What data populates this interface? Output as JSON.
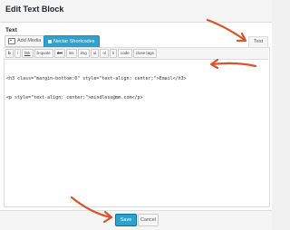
{
  "modal": {
    "title": "Edit Text Block"
  },
  "field": {
    "label": "Text"
  },
  "media_buttons": {
    "add_media": "Add Media",
    "nectar": "Nectar Shortcodes"
  },
  "editor_tabs": {
    "text": "Text"
  },
  "quicktags": [
    {
      "label": "b",
      "icon": "bold"
    },
    {
      "label": "i",
      "icon": "italic"
    },
    {
      "label": "link",
      "icon": "link"
    },
    {
      "label": "b-quote",
      "icon": "blockquote"
    },
    {
      "label": "del",
      "icon": "strikethrough"
    },
    {
      "label": "ins",
      "icon": "insert"
    },
    {
      "label": "img",
      "icon": "image"
    },
    {
      "label": "ul",
      "icon": "unordered-list"
    },
    {
      "label": "ol",
      "icon": "ordered-list"
    },
    {
      "label": "li",
      "icon": "list-item"
    },
    {
      "label": "code",
      "icon": "code"
    },
    {
      "label": "close tags",
      "icon": "close-tags"
    }
  ],
  "editor": {
    "line1": "<h3 class=\"margin-bottom:0\" style=\"text-align: center;\">Email</h3>",
    "line2": "<p style=\"text-align: center;\">mindless@mm.com</p>"
  },
  "footer": {
    "save": "Save",
    "cancel": "Cancel"
  },
  "colors": {
    "primary": "#2ea2cc",
    "arrow": "#d9542b"
  }
}
